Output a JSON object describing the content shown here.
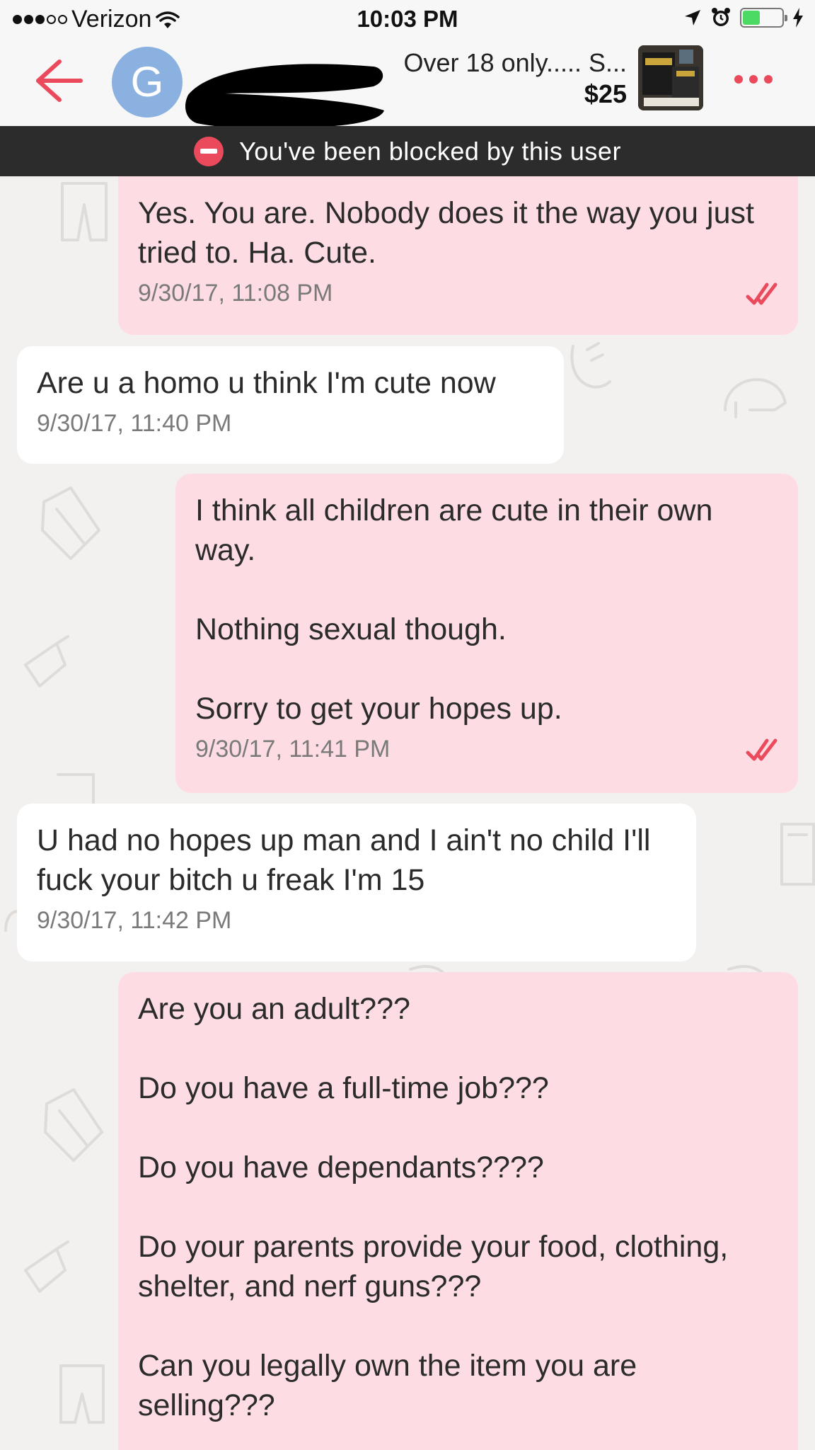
{
  "status_bar": {
    "carrier": "Verizon",
    "time": "10:03 PM"
  },
  "header": {
    "avatar_initial": "G",
    "listing_title": "Over 18 only..... S...",
    "listing_price": "$25"
  },
  "banner": {
    "text": "You've been blocked by this user"
  },
  "messages": [
    {
      "direction": "sent",
      "text": "Yes.  You are.  Nobody does it the way you just tried to.  Ha.  Cute.",
      "timestamp": "9/30/17, 11:08 PM",
      "read": true
    },
    {
      "direction": "received",
      "text": "Are u a homo u think I'm cute now",
      "timestamp": "9/30/17, 11:40 PM"
    },
    {
      "direction": "sent",
      "text": "I think all children are cute in their own way.\n\nNothing sexual though.\n\nSorry to get your hopes up.",
      "timestamp": "9/30/17, 11:41 PM",
      "read": true
    },
    {
      "direction": "received",
      "text": "U had no hopes up man and I ain't no child I'll fuck your bitch u freak I'm 15",
      "timestamp": "9/30/17, 11:42 PM"
    },
    {
      "direction": "sent",
      "text": "Are you an adult???\n\nDo you have a full-time job???\n\nDo you have dependants????\n\nDo your parents provide your food, clothing, shelter, and nerf guns???\n\nCan you legally own the item you are selling???"
    }
  ],
  "colors": {
    "accent": "#ea4a5c",
    "sent_bubble": "#fddde3",
    "received_bubble": "#ffffff",
    "banner_bg": "#2c2c2c",
    "avatar_bg": "#8ab1e0",
    "chat_bg": "#f3f1f0"
  },
  "icons": {
    "back": "arrow-left-icon",
    "more": "more-dots-icon",
    "blocked": "blocked-icon",
    "read": "double-check-icon",
    "wifi": "wifi-icon",
    "location": "location-arrow-icon",
    "alarm": "alarm-icon",
    "battery": "battery-icon",
    "charging": "charging-bolt-icon"
  }
}
